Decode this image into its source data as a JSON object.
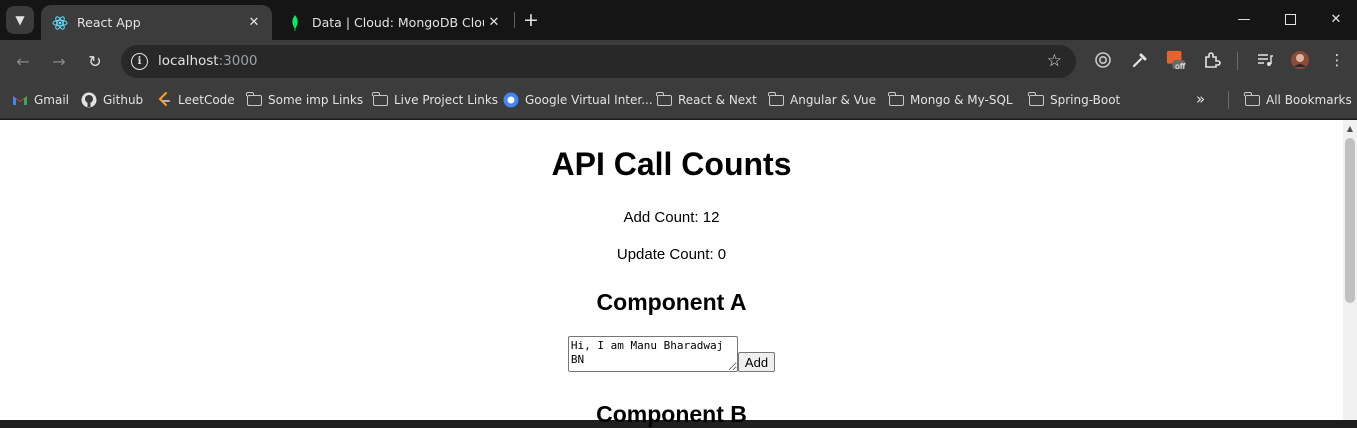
{
  "tabs": [
    {
      "title": "React App",
      "favicon": "react-icon"
    },
    {
      "title": "Data | Cloud: MongoDB Cloud",
      "favicon": "mongodb-leaf-icon"
    }
  ],
  "address_bar": {
    "host": "localhost",
    "port": ":3000"
  },
  "bookmarks": [
    {
      "label": "Gmail",
      "icon": "gmail-icon"
    },
    {
      "label": "Github",
      "icon": "github-icon"
    },
    {
      "label": "LeetCode",
      "icon": "leetcode-icon"
    },
    {
      "label": "Some imp Links",
      "icon": "folder-icon"
    },
    {
      "label": "Live Project Links",
      "icon": "folder-icon"
    },
    {
      "label": "Google Virtual Inter...",
      "icon": "google-icon"
    },
    {
      "label": "React & Next",
      "icon": "folder-icon"
    },
    {
      "label": "Angular & Vue",
      "icon": "folder-icon"
    },
    {
      "label": "Mongo & My-SQL",
      "icon": "folder-icon"
    },
    {
      "label": "Spring-Boot",
      "icon": "folder-icon"
    },
    {
      "label": "All Bookmarks",
      "icon": "folder-icon"
    }
  ],
  "extensions": {
    "badge": "off"
  },
  "page": {
    "title": "API Call Counts",
    "add_count": "Add Count: 12",
    "update_count": "Update Count: 0",
    "component_a": {
      "heading": "Component A",
      "textarea_value": "Hi, I am Manu Bharadwaj BN",
      "button_label": "Add"
    },
    "component_b": {
      "heading": "Component B"
    }
  },
  "colors": {
    "page_bg": "#ffffff",
    "chrome_bg": "#3c3c3c",
    "tabstrip_bg": "#151515"
  }
}
